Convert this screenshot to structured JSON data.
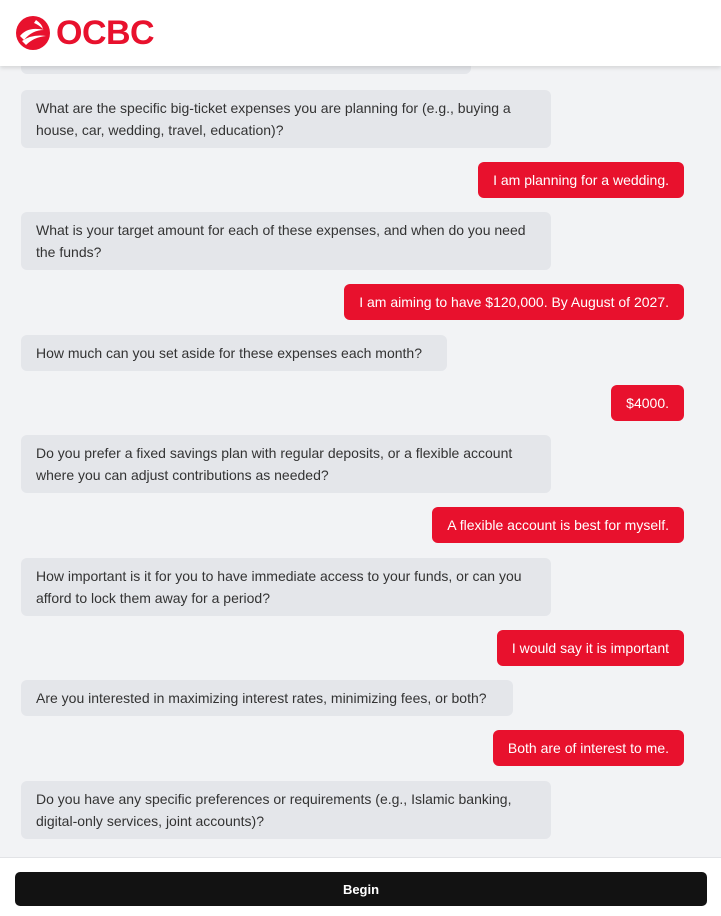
{
  "brand": {
    "name": "OCBC",
    "color": "#e8112d",
    "icon": "ocbc-logo-icon"
  },
  "messages": [
    {
      "role": "bot",
      "text": "What are the specific big-ticket expenses you are planning for (e.g., buying a house, car, wedding, travel, education)?"
    },
    {
      "role": "user",
      "text": "I am planning for a wedding."
    },
    {
      "role": "bot",
      "text": "What is your target amount for each of these expenses, and when do you need the funds?"
    },
    {
      "role": "user",
      "text": "I am aiming to have $120,000. By August of 2027."
    },
    {
      "role": "bot",
      "text": "How much can you set aside for these expenses each month?"
    },
    {
      "role": "user",
      "text": "$4000."
    },
    {
      "role": "bot",
      "text": "Do you prefer a fixed savings plan with regular deposits, or a flexible account where you can adjust contributions as needed?"
    },
    {
      "role": "user",
      "text": "A flexible account is best for myself."
    },
    {
      "role": "bot",
      "text": "How important is it for you to have immediate access to your funds, or can you afford to lock them away for a period?"
    },
    {
      "role": "user",
      "text": "I would say it is important"
    },
    {
      "role": "bot",
      "text": "Are you interested in maximizing interest rates, minimizing fees, or both?"
    },
    {
      "role": "user",
      "text": "Both are of interest to me."
    },
    {
      "role": "bot",
      "text": "Do you have any specific preferences or requirements (e.g., Islamic banking, digital-only services, joint accounts)?"
    }
  ],
  "footer": {
    "begin_label": "Begin"
  },
  "colors": {
    "user_bubble": "#e8112d",
    "bot_bubble": "#e4e6ea",
    "background": "#f2f3f5",
    "button": "#121212"
  }
}
